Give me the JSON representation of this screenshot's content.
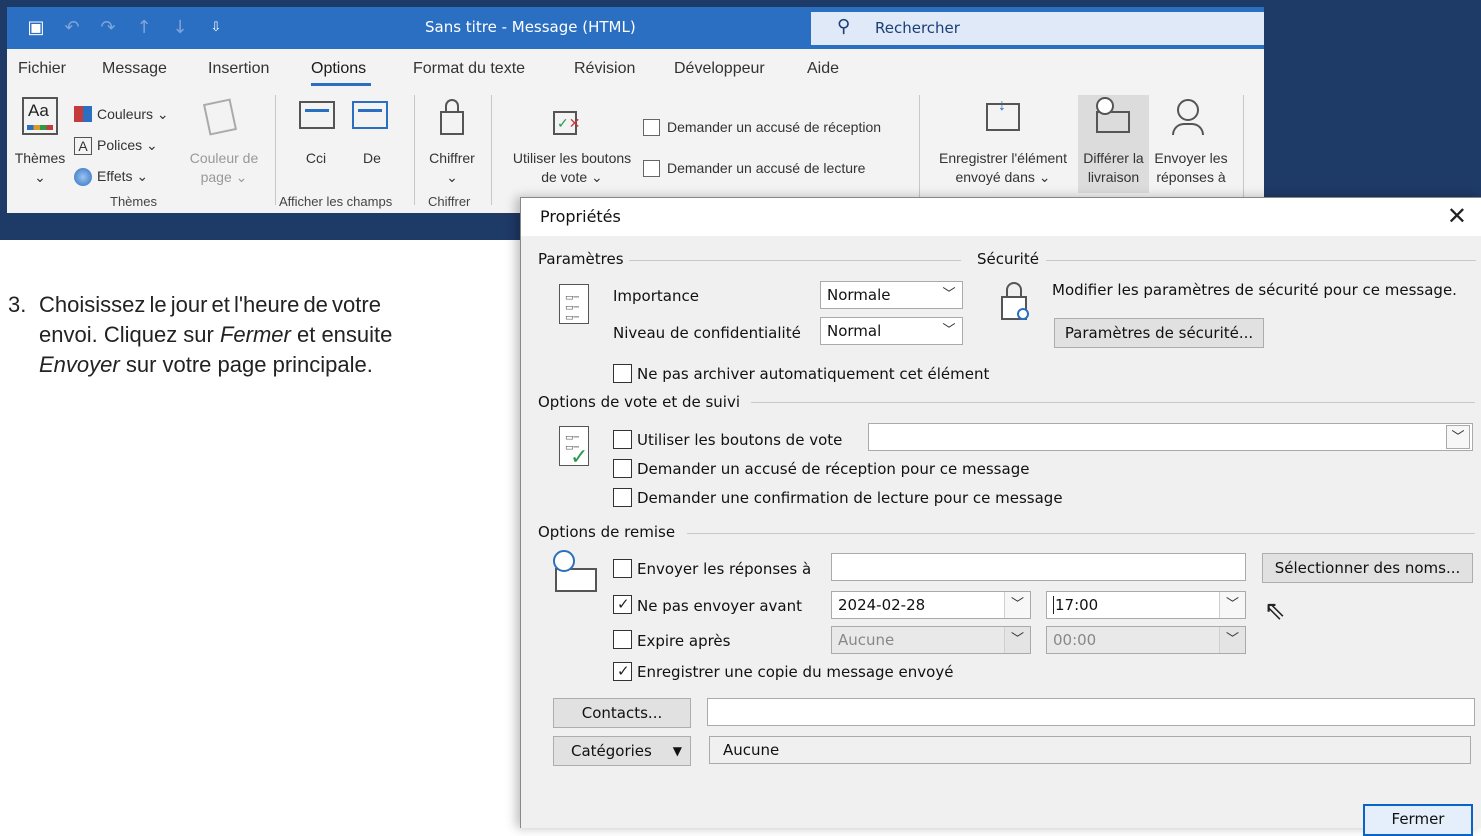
{
  "window": {
    "title": "Sans titre  -  Message (HTML)",
    "search_label": "Rechercher",
    "qat_icons": [
      "save-icon",
      "undo-icon",
      "redo-icon",
      "up-arrow-icon",
      "down-arrow-icon",
      "customize-qat-icon"
    ]
  },
  "menu": {
    "items": [
      "Fichier",
      "Message",
      "Insertion",
      "Options",
      "Format du texte",
      "Révision",
      "Développeur",
      "Aide"
    ],
    "active": "Options"
  },
  "ribbon": {
    "themes_label": "Thèmes",
    "colors_label": "Couleurs",
    "fonts_label": "Polices",
    "effects_label": "Effets",
    "page_color_label_1": "Couleur de",
    "page_color_label_2": "page",
    "group_themes": "Thèmes",
    "cci_label": "Cci",
    "de_label": "De",
    "group_fields": "Afficher les champs",
    "encrypt_label": "Chiffrer",
    "group_encrypt": "Chiffrer",
    "vote_label_1": "Utiliser les boutons",
    "vote_label_2": "de vote",
    "receipt_label": "Demander un accusé de réception",
    "read_label": "Demander un accusé de lecture",
    "save_sent_1": "Enregistrer l'élément",
    "save_sent_2": "envoyé dans",
    "delay_1": "Différer la",
    "delay_2": "livraison",
    "replies_1": "Envoyer les",
    "replies_2": "réponses à"
  },
  "instruction": {
    "number": "3.",
    "line1": "Choisissez  le  jour  et  l'heure  de  votre",
    "line2_a": "envoi.  Cliquez  sur ",
    "line2_em": "Fermer",
    "line2_b": " et  ensuite",
    "line3_em": "Envoyer",
    "line3_b": " sur votre page principale."
  },
  "dialog": {
    "title": "Propriétés",
    "close": "✕",
    "settings_header": "Paramètres",
    "importance_label": "Importance",
    "importance_value": "Normale",
    "sensitivity_label": "Niveau de confidentialité",
    "sensitivity_value": "Normal",
    "no_archive_label": "Ne pas archiver automatiquement cet élément",
    "security_header": "Sécurité",
    "security_text": "Modifier les paramètres de sécurité pour ce message.",
    "security_button": "Paramètres de sécurité...",
    "voting_header": "Options de vote et de suivi",
    "use_voting_label": "Utiliser les boutons de vote",
    "voting_value": "",
    "delivery_receipt_label": "Demander un accusé de réception pour ce message",
    "read_receipt_label": "Demander une confirmation de lecture pour ce message",
    "delivery_header": "Options de remise",
    "reply_to_label": "Envoyer les réponses à",
    "reply_to_value": "",
    "select_names_button": "Sélectionner des noms...",
    "defer_label": "Ne pas envoyer avant",
    "defer_checked": true,
    "defer_date": "2024-02-28",
    "defer_time": "17:00",
    "expire_label": "Expire après",
    "expire_checked": false,
    "expire_date": "Aucune",
    "expire_time": "00:00",
    "save_copy_label": "Enregistrer une copie du message envoyé",
    "save_copy_checked": true,
    "contacts_button": "Contacts...",
    "contacts_value": "",
    "categories_button": "Catégories",
    "categories_value": "Aucune",
    "close_button": "Fermer"
  },
  "colors": {
    "titlebar": "#2b6fc2",
    "background_navy": "#1e3a66",
    "accent": "#0a64c8"
  }
}
